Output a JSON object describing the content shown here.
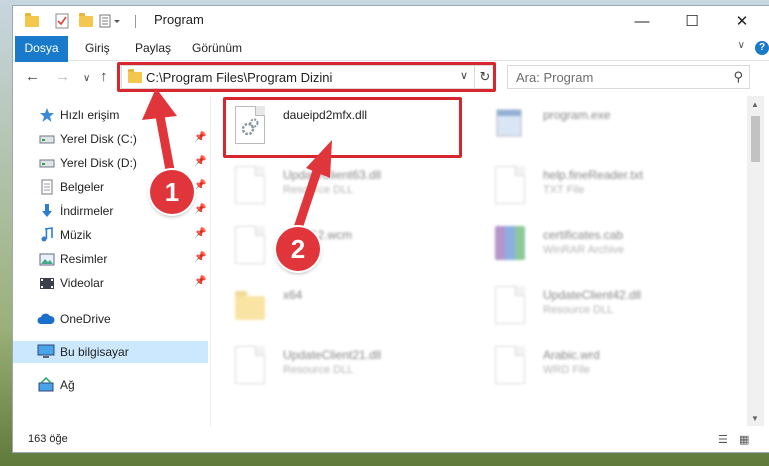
{
  "window": {
    "title": "Program"
  },
  "ribbon": {
    "tabs": [
      "Dosya",
      "Giriş",
      "Paylaş",
      "Görünüm"
    ]
  },
  "nav": {
    "address": "C:\\Program Files\\Program Dizini",
    "search_placeholder": "Ara: Program"
  },
  "sidebar": {
    "items": [
      {
        "label": "Hızlı erişim",
        "icon": "star-icon"
      },
      {
        "label": "Yerel Disk (C:)",
        "icon": "drive-icon",
        "pinned": true
      },
      {
        "label": "Yerel Disk (D:)",
        "icon": "drive-icon",
        "pinned": true
      },
      {
        "label": "Belgeler",
        "icon": "documents-icon",
        "pinned": true
      },
      {
        "label": "İndirmeler",
        "icon": "download-icon",
        "pinned": true
      },
      {
        "label": "Müzik",
        "icon": "music-icon",
        "pinned": true
      },
      {
        "label": "Resimler",
        "icon": "pictures-icon",
        "pinned": true
      },
      {
        "label": "Videolar",
        "icon": "videos-icon",
        "pinned": true
      },
      {
        "label": "OneDrive",
        "icon": "cloud-icon"
      },
      {
        "label": "Bu bilgisayar",
        "icon": "computer-icon",
        "selected": true
      },
      {
        "label": "Ağ",
        "icon": "network-icon"
      }
    ]
  },
  "files": [
    {
      "name": "daueipd2mfx.dll",
      "type": "",
      "icon": "dll-icon",
      "highlight": true
    },
    {
      "name": "program.exe",
      "type": "",
      "icon": "exe-icon"
    },
    {
      "name": "UpdateClient63.dll",
      "type": "Resource DLL",
      "icon": "dll-icon"
    },
    {
      "name": "help.fineReader.txt",
      "type": "TXT File",
      "icon": "txt-icon"
    },
    {
      "name": "RWP12.wcm",
      "type": "File",
      "icon": "file-icon"
    },
    {
      "name": "certificates.cab",
      "type": "WinRAR Archive",
      "icon": "archive-icon"
    },
    {
      "name": "x64",
      "type": "",
      "icon": "folder-icon"
    },
    {
      "name": "UpdateClient42.dll",
      "type": "Resource DLL",
      "icon": "dll-icon"
    },
    {
      "name": "UpdateClient21.dll",
      "type": "Resource DLL",
      "icon": "dll-icon"
    },
    {
      "name": "Arabic.wrd",
      "type": "WRD File",
      "icon": "file-icon"
    }
  ],
  "status": {
    "count": "163 öğe"
  },
  "annotations": {
    "one": "1",
    "two": "2"
  },
  "colors": {
    "accent": "#1979ca",
    "highlight": "#d8262e",
    "selected": "#cce8ff"
  }
}
